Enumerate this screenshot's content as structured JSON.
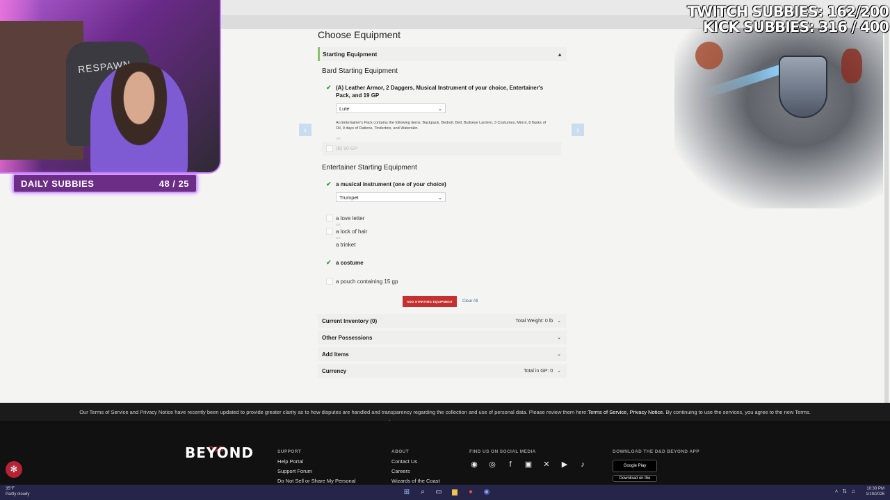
{
  "stream": {
    "daily_subbies_label": "DAILY SUBBIES",
    "daily_subbies_value": "48 / 25",
    "twitch_counter": "TWITCH SUBBIES: 162/200",
    "kick_counter": "KICK SUBBIES: 316 / 400",
    "chair_text": "RESPAWN"
  },
  "page": {
    "title": "Choose Equipment",
    "starting_equipment_label": "Starting Equipment",
    "bard_title": "Bard Starting Equipment",
    "option_a_label": "(A) Leather Armor, 2 Daggers, Musical Instrument of your choice, Entertainer's Pack, and 19 GP",
    "option_a_select": "Lute",
    "option_a_note": "An Entertainer's Pack contains the following items: Backpack, Bedroll, Bell, Bullseye Lantern, 3 Costumes, Mirror, 8 flasks of Oil, 9 days of Rations, Tinderbox, and Waterskin.",
    "or_label": "OR",
    "option_b_label": "(B) 90 GP",
    "entertainer_title": "Entertainer Starting Equipment",
    "instrument_label": "a musical instrument (one of your choice)",
    "instrument_select": "Trumpet",
    "love_letter": "a love letter",
    "lock_of_hair": "a lock of hair",
    "trinket": "a trinket",
    "costume": "a costume",
    "pouch": "a pouch containing 15 gp",
    "add_button": "ADD STARTING EQUIPMENT",
    "clear_all": "Clear All",
    "current_inventory": "Current Inventory (0)",
    "total_weight": "Total Weight: 0 lb",
    "other_possessions": "Other Possessions",
    "add_items": "Add Items",
    "currency": "Currency",
    "total_gp": "Total in GP: 0"
  },
  "terms": {
    "text": "Our Terms of Service and Privacy Notice have recently been updated to provide greater clarity as to how disputes are handled and transparency regarding the collection and use of personal data. Please review them here: ",
    "tos_link": "Terms of Service",
    "privacy_link": "Privacy Notice",
    "text_end": ". By continuing to use the services, you agree to the new Terms."
  },
  "footer": {
    "logo_top": "D&D",
    "logo": "BEYOND",
    "support_head": "SUPPORT",
    "support_items": [
      "Help Portal",
      "Support Forum",
      "Do Not Sell or Share My Personal"
    ],
    "about_head": "ABOUT",
    "about_items": [
      "Contact Us",
      "Careers",
      "Wizards of the Coast"
    ],
    "social_head": "FIND US ON SOCIAL MEDIA",
    "app_head": "DOWNLOAD THE D&D BEYOND APP",
    "google_play": "Google Play",
    "app_store": "Download on the"
  },
  "taskbar": {
    "temperature": "35°F",
    "weather": "Partly cloudy",
    "time": "10:30 PM",
    "date": "1/19/2026"
  }
}
